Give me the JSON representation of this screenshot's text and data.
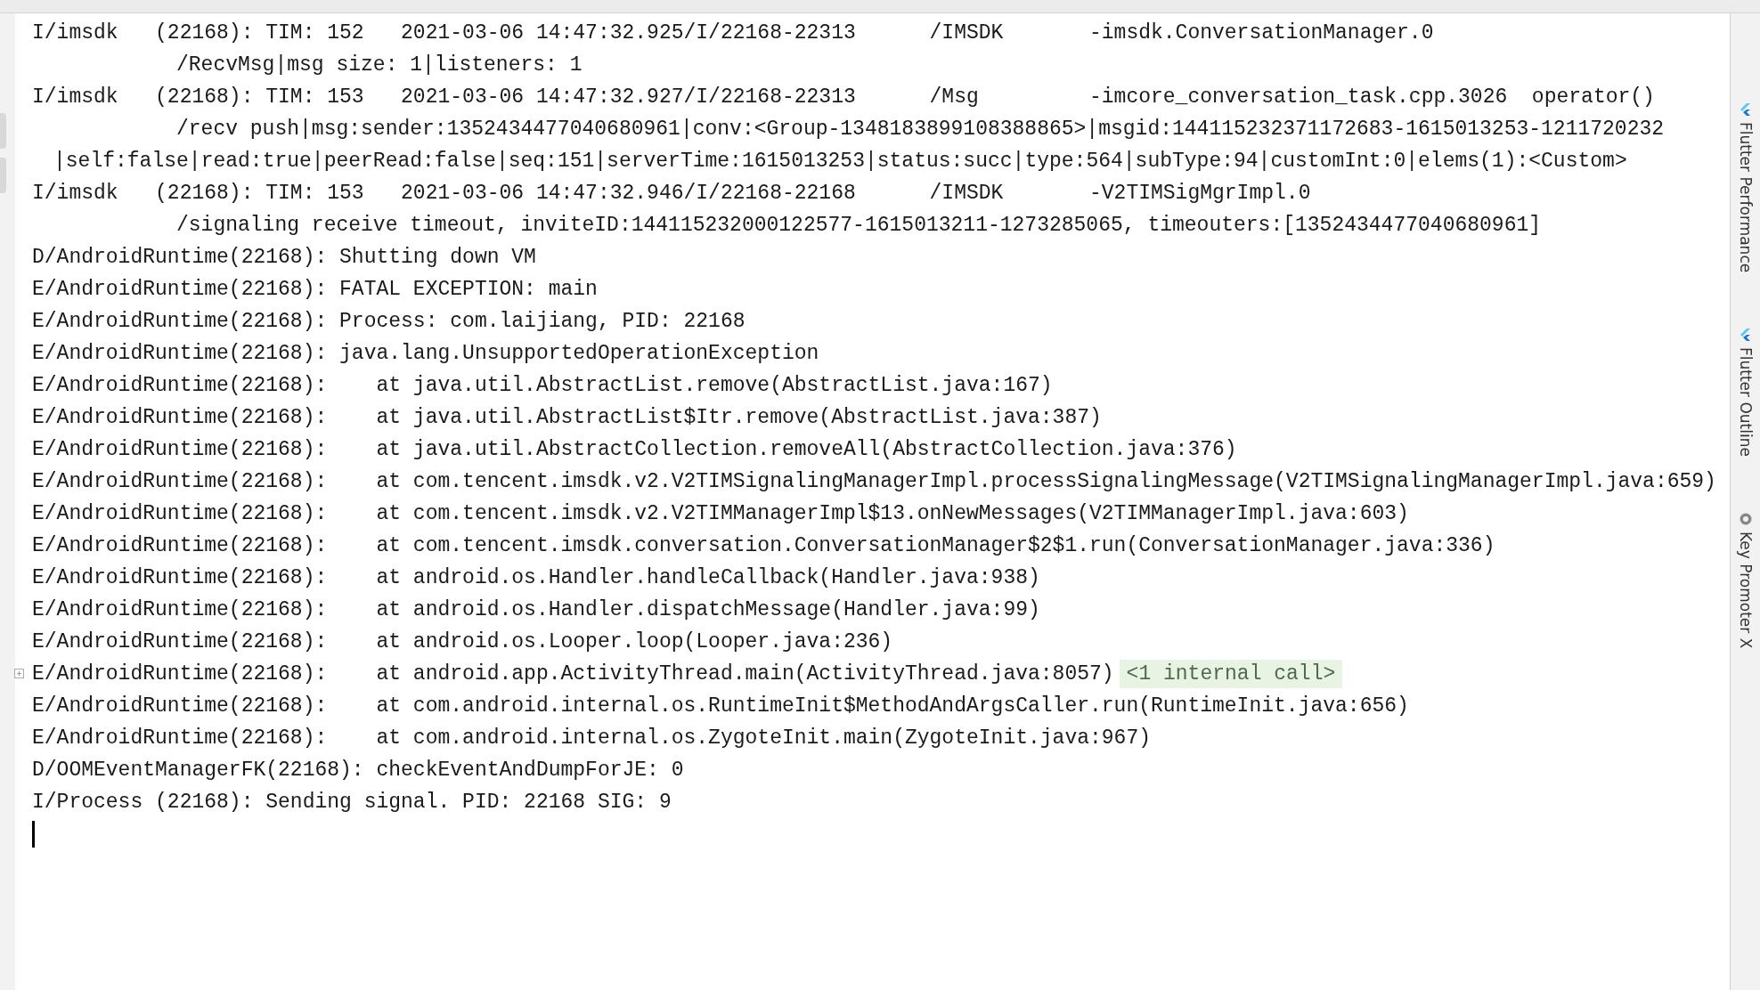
{
  "console": {
    "lines": [
      {
        "kind": "log",
        "text": "I/imsdk   (22168): TIM: 152   2021-03-06 14:47:32.925/I/22168-22313      /IMSDK       -imsdk.ConversationManager.0"
      },
      {
        "kind": "wrap",
        "text": "/RecvMsg|msg size: 1|listeners: 1"
      },
      {
        "kind": "log",
        "text": "I/imsdk   (22168): TIM: 153   2021-03-06 14:47:32.927/I/22168-22313      /Msg         -imcore_conversation_task.cpp.3026  operator()"
      },
      {
        "kind": "wrap",
        "text": "/recv push|msg:sender:1352434477040680961|conv:<Group-1348183899108388865>|msgid:144115232371172683-1615013253-1211720232"
      },
      {
        "kind": "wrap2",
        "text": "|self:false|read:true|peerRead:false|seq:151|serverTime:1615013253|status:succ|type:564|subType:94|customInt:0|elems(1):<Custom>"
      },
      {
        "kind": "log",
        "text": "I/imsdk   (22168): TIM: 153   2021-03-06 14:47:32.946/I/22168-22168      /IMSDK       -V2TIMSigMgrImpl.0"
      },
      {
        "kind": "wrap",
        "text": "/signaling receive timeout, inviteID:144115232000122577-1615013211-1273285065, timeouters:[1352434477040680961]"
      },
      {
        "kind": "log",
        "text": "D/AndroidRuntime(22168): Shutting down VM"
      },
      {
        "kind": "log",
        "text": "E/AndroidRuntime(22168): FATAL EXCEPTION: main"
      },
      {
        "kind": "log",
        "text": "E/AndroidRuntime(22168): Process: com.laijiang, PID: 22168"
      },
      {
        "kind": "log",
        "text": "E/AndroidRuntime(22168): java.lang.UnsupportedOperationException"
      },
      {
        "kind": "log",
        "text": "E/AndroidRuntime(22168):    at java.util.AbstractList.remove(AbstractList.java:167)"
      },
      {
        "kind": "log",
        "text": "E/AndroidRuntime(22168):    at java.util.AbstractList$Itr.remove(AbstractList.java:387)"
      },
      {
        "kind": "log",
        "text": "E/AndroidRuntime(22168):    at java.util.AbstractCollection.removeAll(AbstractCollection.java:376)"
      },
      {
        "kind": "log",
        "text": "E/AndroidRuntime(22168):    at com.tencent.imsdk.v2.V2TIMSignalingManagerImpl.processSignalingMessage(V2TIMSignalingManagerImpl.java:659)"
      },
      {
        "kind": "log",
        "text": "E/AndroidRuntime(22168):    at com.tencent.imsdk.v2.V2TIMManagerImpl$13.onNewMessages(V2TIMManagerImpl.java:603)"
      },
      {
        "kind": "log",
        "text": "E/AndroidRuntime(22168):    at com.tencent.imsdk.conversation.ConversationManager$2$1.run(ConversationManager.java:336)"
      },
      {
        "kind": "log",
        "text": "E/AndroidRuntime(22168):    at android.os.Handler.handleCallback(Handler.java:938)"
      },
      {
        "kind": "log",
        "text": "E/AndroidRuntime(22168):    at android.os.Handler.dispatchMessage(Handler.java:99)"
      },
      {
        "kind": "log",
        "text": "E/AndroidRuntime(22168):    at android.os.Looper.loop(Looper.java:236)"
      },
      {
        "kind": "log",
        "text": "E/AndroidRuntime(22168):    at android.app.ActivityThread.main(ActivityThread.java:8057)",
        "folded": true,
        "note": "<1 internal call>"
      },
      {
        "kind": "log",
        "text": "E/AndroidRuntime(22168):    at com.android.internal.os.RuntimeInit$MethodAndArgsCaller.run(RuntimeInit.java:656)"
      },
      {
        "kind": "log",
        "text": "E/AndroidRuntime(22168):    at com.android.internal.os.ZygoteInit.main(ZygoteInit.java:967)"
      },
      {
        "kind": "log",
        "text": "D/OOMEventManagerFK(22168): checkEventAndDumpForJE: 0"
      },
      {
        "kind": "log",
        "text": "I/Process (22168): Sending signal. PID: 22168 SIG: 9"
      }
    ]
  },
  "side_tabs": [
    {
      "label": "Flutter Performance"
    },
    {
      "label": "Flutter Outline"
    },
    {
      "label": "Key Promoter X"
    }
  ]
}
